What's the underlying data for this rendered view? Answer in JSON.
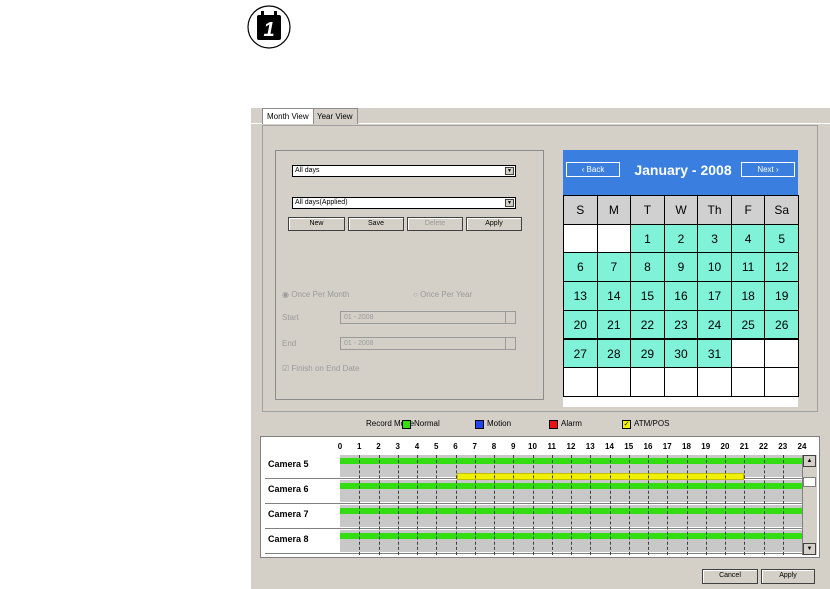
{
  "badge": {
    "number": "1"
  },
  "tabs": [
    {
      "label": "Month View"
    },
    {
      "label": "Year View"
    }
  ],
  "schedule": {
    "combo1_value": "All days",
    "combo2_value": "All days(Applied)",
    "buttons": {
      "new": "New",
      "save": "Save",
      "delete": "Delete",
      "apply": "Apply"
    },
    "radio_month": "Once Per Month",
    "radio_year": "Once Per Year",
    "start_label": "Start",
    "start_value": "01 - 2008",
    "end_label": "End",
    "end_value": "01 - 2008",
    "finish_label": "Finish on End Date"
  },
  "calendar": {
    "back_label": "‹ Back",
    "next_label": "Next ›",
    "title": "January - 2008",
    "weekdays": [
      "S",
      "M",
      "T",
      "W",
      "Th",
      "F",
      "Sa"
    ],
    "days": [
      "1",
      "2",
      "3",
      "4",
      "5",
      "6",
      "7",
      "8",
      "9",
      "10",
      "11",
      "12",
      "13",
      "14",
      "15",
      "16",
      "17",
      "18",
      "19",
      "20",
      "21",
      "22",
      "23",
      "24",
      "25",
      "26",
      "27",
      "28",
      "29",
      "30",
      "31"
    ],
    "highlight_color": "#7ff2d8",
    "header_color": "#3a7fe0"
  },
  "legend": {
    "title": "Record Mode",
    "items": [
      {
        "label": "Normal",
        "color": "#33dd11"
      },
      {
        "label": "Motion",
        "color": "#2244ee"
      },
      {
        "label": "Alarm",
        "color": "#ee1111"
      },
      {
        "label": "ATM/POS",
        "color": "#f0f000"
      }
    ]
  },
  "timeline": {
    "hours": [
      "0",
      "1",
      "2",
      "3",
      "4",
      "5",
      "6",
      "7",
      "8",
      "9",
      "10",
      "11",
      "12",
      "13",
      "14",
      "15",
      "16",
      "17",
      "18",
      "19",
      "20",
      "21",
      "22",
      "23",
      "24"
    ],
    "cameras": [
      {
        "name": "Camera 5"
      },
      {
        "name": "Camera 6"
      },
      {
        "name": "Camera 7"
      },
      {
        "name": "Camera 8"
      }
    ]
  },
  "footer": {
    "cancel": "Cancel",
    "apply": "Apply"
  }
}
